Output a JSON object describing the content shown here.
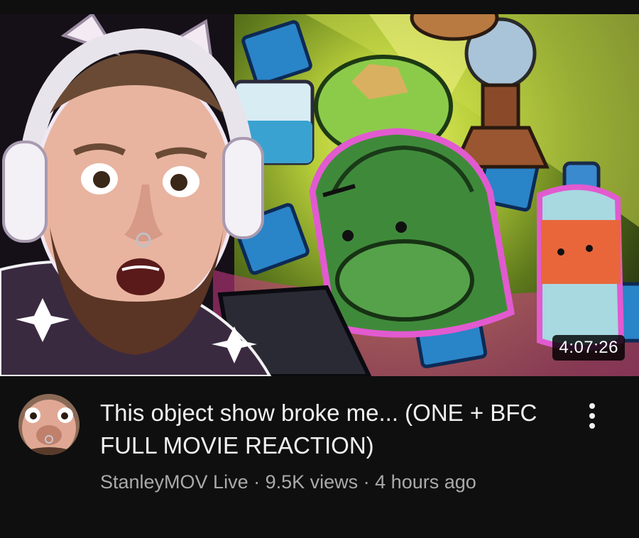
{
  "video": {
    "duration": "4:07:26",
    "title": "This object show broke me... (ONE + BFC FULL MOVIE REACTION)",
    "channel": "StanleyMOV Live",
    "views": "9.5K views",
    "age": "4 hours ago",
    "separator": " · "
  },
  "icons": {
    "more": "more-vert-icon"
  },
  "colors": {
    "background": "#0f0f0f",
    "title": "#f1f1f1",
    "meta": "#aaaaaa"
  }
}
